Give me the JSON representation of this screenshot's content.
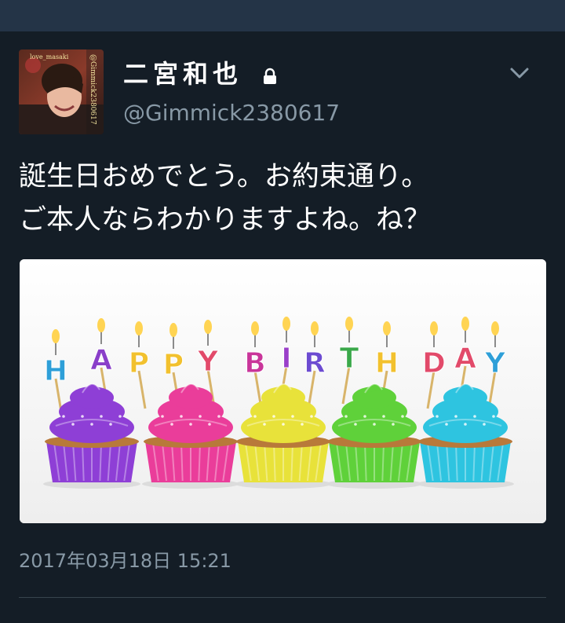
{
  "tweet": {
    "display_name": "二宮和也",
    "handle": "@Gimmick2380617",
    "text_lines": [
      "誕生日おめでとう。お約束通り。",
      "ご本人ならわかりますよね。ね？"
    ],
    "timestamp": "2017年03月18日 15:21",
    "protected_icon": "lock-icon",
    "menu_icon": "chevron-down-icon",
    "avatar_watermark": "@Gimmick2380617",
    "avatar_watermark_2": "love_masaki"
  },
  "media": {
    "candle_letters": [
      "H",
      "A",
      "P",
      "P",
      "Y",
      "B",
      "I",
      "R",
      "T",
      "H",
      "D",
      "A",
      "Y"
    ],
    "cupcake_colors": [
      "#8e3fd6",
      "#ea3d9a",
      "#e8e23a",
      "#5fd13a",
      "#2ec4e0"
    ]
  },
  "colors": {
    "background": "#141d26",
    "topbar": "#243447",
    "secondary_text": "#8899a6",
    "divider": "#38444d"
  }
}
